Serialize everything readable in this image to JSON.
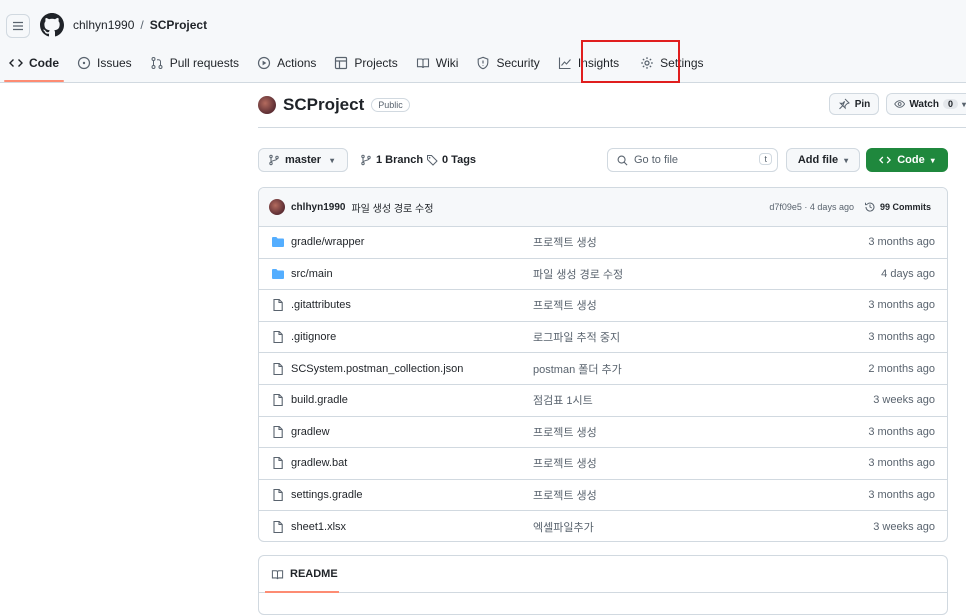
{
  "header": {
    "owner": "chlhyn1990",
    "separator": "/",
    "repo": "SCProject"
  },
  "tabs": [
    {
      "label": "Code",
      "icon": "code-icon"
    },
    {
      "label": "Issues",
      "icon": "issue-icon"
    },
    {
      "label": "Pull requests",
      "icon": "pull-request-icon"
    },
    {
      "label": "Actions",
      "icon": "play-icon"
    },
    {
      "label": "Projects",
      "icon": "table-icon"
    },
    {
      "label": "Wiki",
      "icon": "book-icon"
    },
    {
      "label": "Security",
      "icon": "shield-icon"
    },
    {
      "label": "Insights",
      "icon": "graph-icon"
    },
    {
      "label": "Settings",
      "icon": "gear-icon"
    }
  ],
  "repo": {
    "name": "SCProject",
    "visibility": "Public",
    "pin_label": "Pin",
    "watch_label": "Watch",
    "watch_count": "0"
  },
  "toolbar": {
    "branch": "master",
    "branch_count": "1 Branch",
    "tag_count": "0 Tags",
    "go_to_file_placeholder": "Go to file",
    "go_to_file_key": "t",
    "add_file_label": "Add file",
    "code_label": "Code"
  },
  "latest_commit": {
    "author": "chlhyn1990",
    "message": "파일 생성 경로 수정",
    "hash_age": "d7f09e5 · 4 days ago",
    "commits": "99 Commits"
  },
  "files": [
    {
      "type": "folder",
      "name": "gradle/wrapper",
      "message": "프로젝트 생성",
      "age": "3 months ago"
    },
    {
      "type": "folder",
      "name": "src/main",
      "message": "파일 생성 경로 수정",
      "age": "4 days ago"
    },
    {
      "type": "file",
      "name": ".gitattributes",
      "message": "프로젝트 생성",
      "age": "3 months ago"
    },
    {
      "type": "file",
      "name": ".gitignore",
      "message": "로그파일 추적 중지",
      "age": "3 months ago"
    },
    {
      "type": "file",
      "name": "SCSystem.postman_collection.json",
      "message": "postman 폴더 추가",
      "age": "2 months ago"
    },
    {
      "type": "file",
      "name": "build.gradle",
      "message": "점검표 1시트",
      "age": "3 weeks ago"
    },
    {
      "type": "file",
      "name": "gradlew",
      "message": "프로젝트 생성",
      "age": "3 months ago"
    },
    {
      "type": "file",
      "name": "gradlew.bat",
      "message": "프로젝트 생성",
      "age": "3 months ago"
    },
    {
      "type": "file",
      "name": "settings.gradle",
      "message": "프로젝트 생성",
      "age": "3 months ago"
    },
    {
      "type": "file",
      "name": "sheet1.xlsx",
      "message": "엑셀파일추가",
      "age": "3 weeks ago"
    }
  ],
  "readme": {
    "label": "README"
  },
  "colors": {
    "accent": "#fd8c73",
    "primary_button": "#1f883d",
    "highlight_box": "#e01e1e",
    "folder": "#54aeff"
  }
}
